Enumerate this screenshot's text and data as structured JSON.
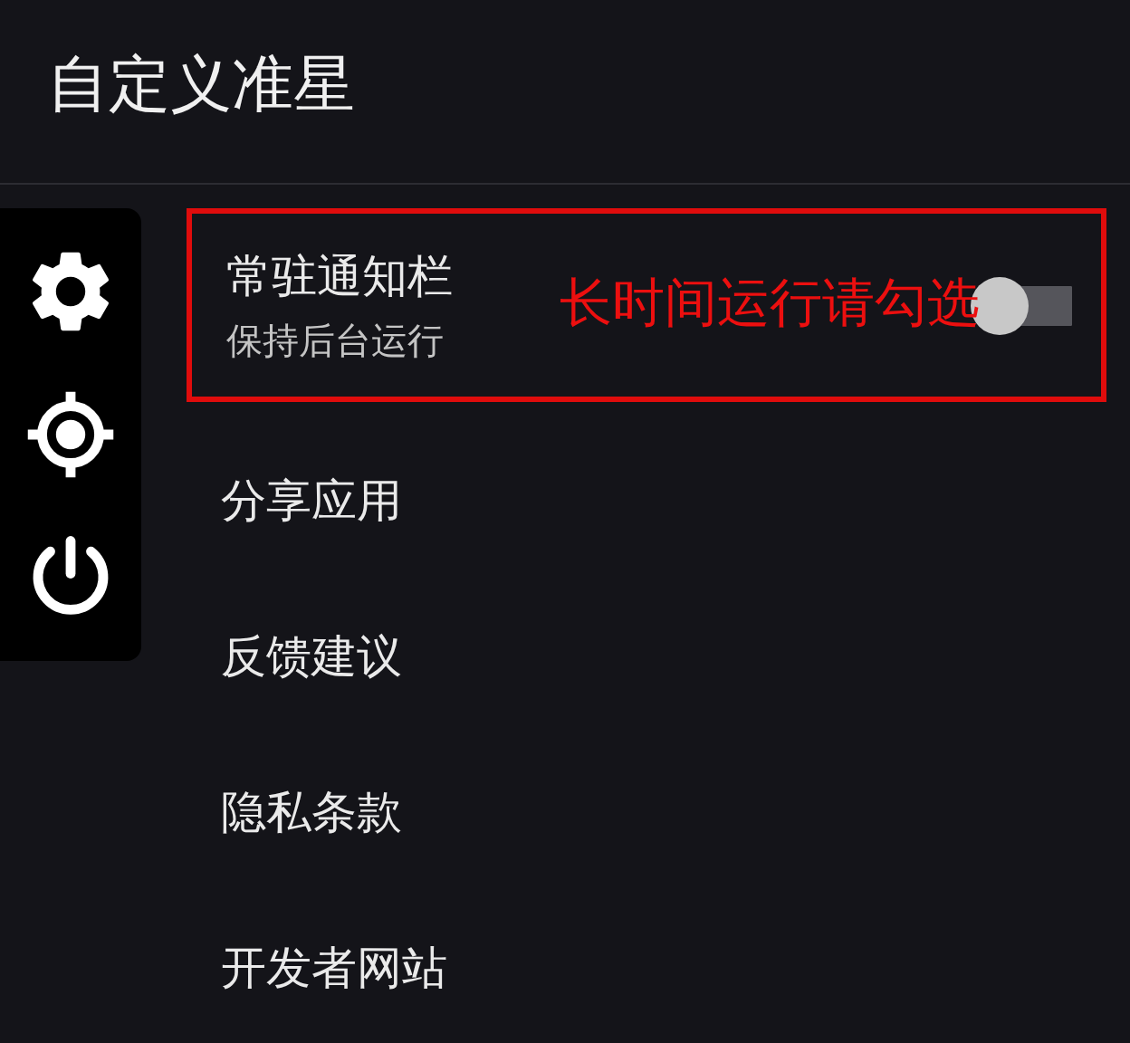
{
  "app_bar": {
    "title": "自定义准星"
  },
  "items": [
    {
      "kind": "toggle",
      "title": "常驻通知栏",
      "subtitle": "保持后台运行",
      "on": false,
      "highlighted": true,
      "annotation": "长时间运行请勾选"
    },
    {
      "kind": "link",
      "title": "分享应用"
    },
    {
      "kind": "link",
      "title": "反馈建议"
    },
    {
      "kind": "link",
      "title": "隐私条款"
    },
    {
      "kind": "link",
      "title": "开发者网站"
    }
  ]
}
